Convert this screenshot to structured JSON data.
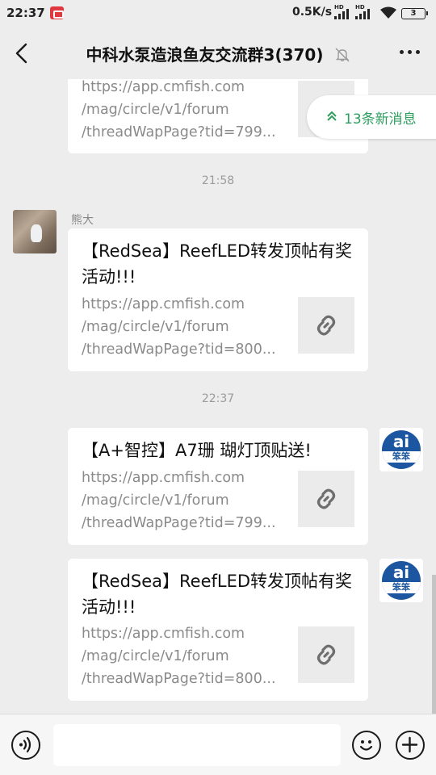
{
  "status_bar": {
    "time": "22:37",
    "net_speed": "0.5K/s",
    "sim1_tag": "HD",
    "sim2_tag": "HD",
    "battery": "3",
    "app_notification_icon": "red-app-icon"
  },
  "header": {
    "title": "中科水泵造浪鱼友交流群3(370)",
    "back_icon": "chevron-left-icon",
    "mute_icon": "bell-off-icon",
    "more_icon": "more-dots-icon"
  },
  "new_messages_pill": {
    "label": "13条新消息",
    "icon": "double-chevron-up-icon",
    "color": "#2e9e5f"
  },
  "messages": [
    {
      "type": "link",
      "partial": true,
      "url_lines": [
        "https://app.cmfish.com",
        "/mag/circle/v1/forum",
        "/threadWapPage?tid=799..."
      ]
    },
    {
      "type": "timestamp",
      "text": "21:58"
    },
    {
      "type": "link",
      "sender": "熊大",
      "title": "【RedSea】ReefLED转发顶帖有奖活动!!!",
      "url_lines": [
        "https://app.cmfish.com",
        "/mag/circle/v1/forum",
        "/threadWapPage?tid=800..."
      ]
    },
    {
      "type": "timestamp",
      "text": "22:37"
    },
    {
      "type": "link",
      "self": true,
      "title": "【A+智控】A7珊 瑚灯顶贴送!",
      "url_lines": [
        "https://app.cmfish.com",
        "/mag/circle/v1/forum",
        "/threadWapPage?tid=799..."
      ]
    },
    {
      "type": "link",
      "self": true,
      "title": "【RedSea】ReefLED转发顶帖有奖活动!!!",
      "url_lines": [
        "https://app.cmfish.com",
        "/mag/circle/v1/forum",
        "/threadWapPage?tid=800..."
      ]
    }
  ],
  "bot_avatar": {
    "letters": "ai",
    "band_text": "笨笨"
  },
  "input_bar": {
    "placeholder": "",
    "voice_icon": "voice-icon",
    "emoji_icon": "emoji-icon",
    "plus_icon": "plus-circle-icon"
  },
  "colors": {
    "background": "#ededed",
    "accent_green": "#2e9e5f",
    "bubble": "#ffffff",
    "meta_text": "#9b9b9b"
  }
}
